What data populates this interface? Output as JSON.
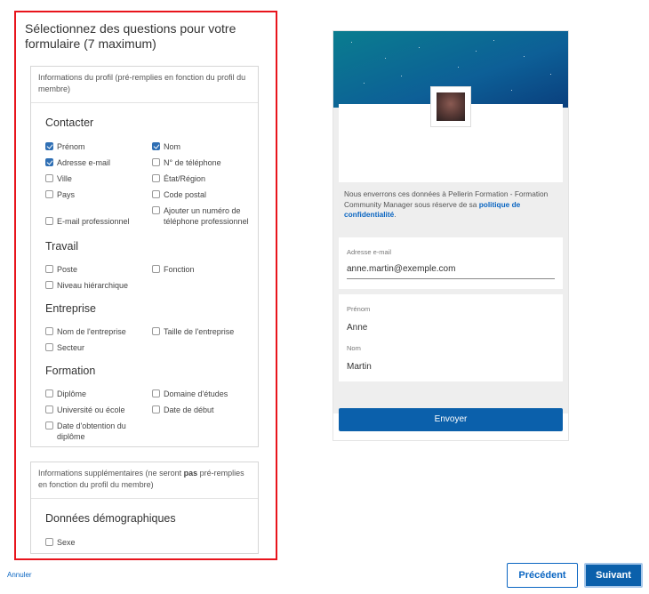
{
  "form": {
    "title": "Sélectionnez des questions pour votre formulaire (7 maximum)",
    "profile_card": {
      "header": "Informations du profil (pré-remplies en fonction du profil du membre)",
      "sections": {
        "contact": "Contacter",
        "work": "Travail",
        "company": "Entreprise",
        "education": "Formation"
      },
      "options": {
        "prenom": {
          "label": "Prénom",
          "checked": true
        },
        "nom": {
          "label": "Nom",
          "checked": true
        },
        "email": {
          "label": "Adresse e-mail",
          "checked": true
        },
        "phone": {
          "label": "N° de téléphone",
          "checked": false
        },
        "city": {
          "label": "Ville",
          "checked": false
        },
        "state": {
          "label": "État/Région",
          "checked": false
        },
        "country": {
          "label": "Pays",
          "checked": false
        },
        "zip": {
          "label": "Code postal",
          "checked": false
        },
        "pro_email": {
          "label": "E-mail professionnel",
          "checked": false
        },
        "pro_phone": {
          "label": "Ajouter un numéro de téléphone professionnel",
          "checked": false
        },
        "job": {
          "label": "Poste",
          "checked": false
        },
        "function": {
          "label": "Fonction",
          "checked": false
        },
        "seniority": {
          "label": "Niveau hiérarchique",
          "checked": false
        },
        "company_name": {
          "label": "Nom de l'entreprise",
          "checked": false
        },
        "company_size": {
          "label": "Taille de l'entreprise",
          "checked": false
        },
        "sector": {
          "label": "Secteur",
          "checked": false
        },
        "degree": {
          "label": "Diplôme",
          "checked": false
        },
        "field_of_study": {
          "label": "Domaine d'études",
          "checked": false
        },
        "school": {
          "label": "Université ou école",
          "checked": false
        },
        "start_date": {
          "label": "Date de début",
          "checked": false
        },
        "grad_date": {
          "label": "Date d'obtention du diplôme",
          "checked": false
        }
      }
    },
    "extra_card": {
      "header_before": "Informations supplémentaires (ne seront ",
      "header_bold": "pas",
      "header_after": " pré-remplies en fonction du profil du membre)",
      "section": "Données démographiques",
      "options": {
        "sex": {
          "label": "Sexe",
          "checked": false
        }
      }
    }
  },
  "preview": {
    "notice_text": "Nous enverrons ces données à Pellerin Formation - Formation Community Manager sous réserve de sa ",
    "notice_link": "politique de confidentialité",
    "notice_end": ".",
    "email_label": "Adresse e-mail",
    "email_value": "anne.martin@exemple.com",
    "first_name_label": "Prénom",
    "first_name_value": "Anne",
    "last_name_label": "Nom",
    "last_name_value": "Martin",
    "submit_label": "Envoyer",
    "banner_colors": [
      "#0a7d8f",
      "#0d5f97",
      "#0a3f7d"
    ]
  },
  "footer": {
    "cancel": "Annuler",
    "previous": "Précédent",
    "next": "Suivant"
  },
  "colors": {
    "highlight_border": "#e8141c",
    "accent": "#0b60ab",
    "checkbox_checked": "#2f6fb4"
  }
}
